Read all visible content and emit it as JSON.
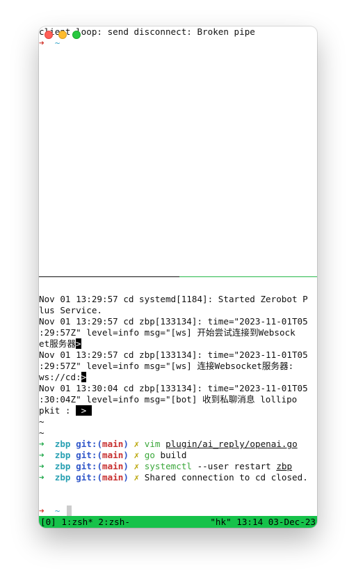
{
  "window": {
    "controls": [
      "close",
      "minimize",
      "zoom"
    ]
  },
  "top_pane": {
    "line1": "client loop: send disconnect: Broken pipe",
    "prompt_arrow": "➜",
    "prompt_dir": "~"
  },
  "log": [
    "Nov 01 13:29:57 cd systemd[1184]: Started Zerobot P",
    "lus Service.",
    "Nov 01 13:29:57 cd zbp[133134]: time=\"2023-11-01T05",
    ":29:57Z\" level=info msg=\"[ws] 开始尝试连接到Websock",
    "et服务器",
    "Nov 01 13:29:57 cd zbp[133134]: time=\"2023-11-01T05",
    ":29:57Z\" level=info msg=\"[ws] 连接Websocket服务器:",
    "ws://cd:",
    "Nov 01 13:30:04 cd zbp[133134]: time=\"2023-11-01T05",
    ":30:04Z\" level=info msg=\"[bot] 收到私聊消息 lollipo",
    "pkit : ",
    "~",
    "~"
  ],
  "inverse_marker": ">",
  "prompts": [
    {
      "arrow": "➜",
      "dir": "zbp",
      "git": "git:(",
      "branch": "main",
      "close": ")",
      "x": "✗",
      "cmd": "vim",
      "arg": "plugin/ai_reply/openai.go"
    },
    {
      "arrow": "➜",
      "dir": "zbp",
      "git": "git:(",
      "branch": "main",
      "close": ")",
      "x": "✗",
      "cmd": "go",
      "arg": "build"
    },
    {
      "arrow": "➜",
      "dir": "zbp",
      "git": "git:(",
      "branch": "main",
      "close": ")",
      "x": "✗",
      "cmd": "systemctl",
      "arg": "--user restart",
      "arg2": "zbp"
    },
    {
      "arrow": "➜",
      "dir": "zbp",
      "git": "git:(",
      "branch": "main",
      "close": ")",
      "x": "✗",
      "text": "Shared connection to cd closed."
    }
  ],
  "bottom_prompt": {
    "arrow": "➜",
    "dir": "~"
  },
  "status": {
    "left": "[0] 1:zsh* 2:zsh-",
    "right": "\"hk\" 13:14 03-Dec-23"
  },
  "colors": {
    "status_bg": "#16c24a",
    "prompt_green": "#1fa84a",
    "branch_red": "#c72f2f",
    "git_blue": "#2f56c9"
  }
}
